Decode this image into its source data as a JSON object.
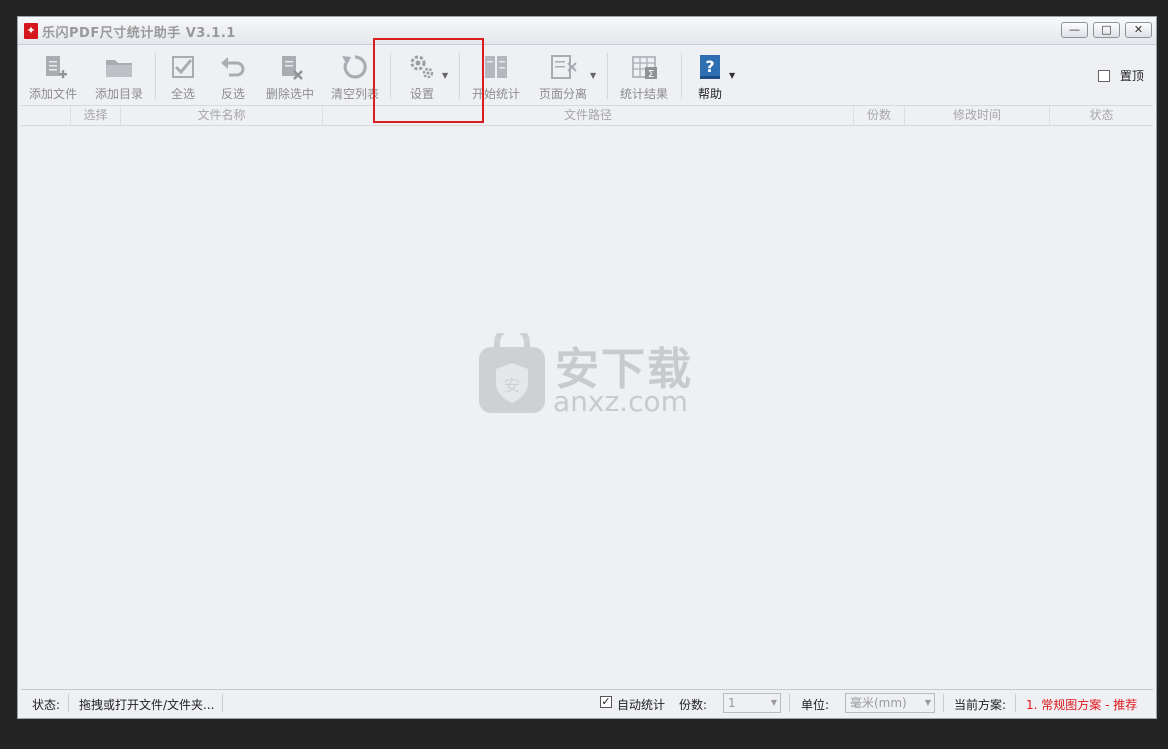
{
  "window": {
    "title": "乐闪PDF尺寸统计助手 V3.1.1",
    "controls": {
      "minimize": "—",
      "maximize": "□",
      "close": "✕"
    }
  },
  "toolbar": {
    "add_file": "添加文件",
    "add_dir": "添加目录",
    "select_all": "全选",
    "invert": "反选",
    "delete_selected": "删除选中",
    "clear_list": "清空列表",
    "settings": "设置",
    "start_count": "开始统计",
    "page_split": "页面分离",
    "count_result": "统计结果",
    "help": "帮助",
    "pin_top": "置顶"
  },
  "table": {
    "columns": [
      "选择",
      "文件名称",
      "文件路径",
      "份数",
      "修改时间",
      "状态"
    ]
  },
  "watermark": {
    "big": "安下载",
    "small": "anxz.com",
    "badge": "安"
  },
  "statusbar": {
    "status_label": "状态:",
    "status_value": "拖拽或打开文件/文件夹...",
    "auto_count": "自动统计",
    "copies_label": "份数:",
    "copies_value": "1",
    "unit_label": "单位:",
    "unit_value": "毫米(mm)",
    "scheme_label": "当前方案:",
    "scheme_value": "1. 常规图方案 - 推荐"
  },
  "colors": {
    "highlight": "#d81e1e",
    "scheme_text": "#e0161a",
    "help_icon": "#2e6fb3"
  }
}
